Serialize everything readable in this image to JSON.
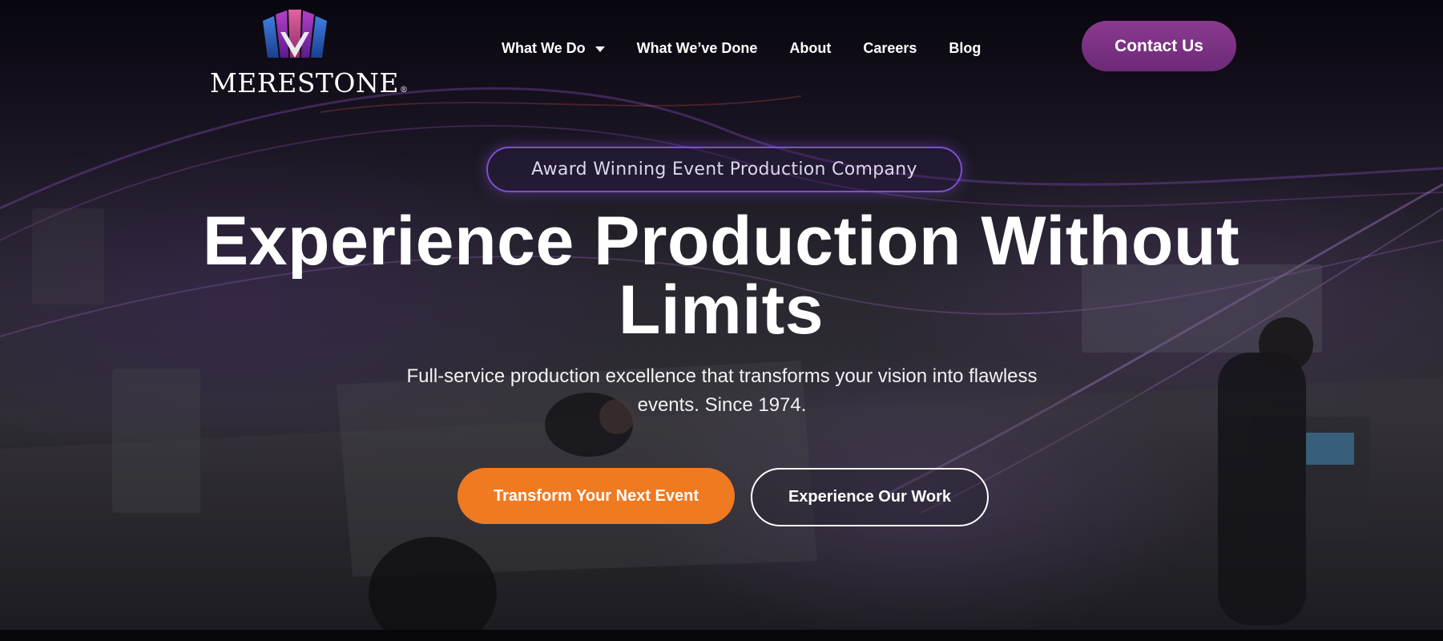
{
  "brand": {
    "logo_text": "MERESTONE",
    "logo_reg": "®"
  },
  "nav": {
    "items": [
      {
        "label": "What We Do"
      },
      {
        "label": "What We’ve Done"
      },
      {
        "label": "About"
      },
      {
        "label": "Careers"
      },
      {
        "label": "Blog"
      }
    ],
    "contact_label": "Contact Us"
  },
  "hero": {
    "badge": "Award Winning Event Production Company",
    "headline_line1": "Experience Production Without",
    "headline_line2": "Limits",
    "subtext_line1": "Full-service production excellence that transforms your vision into flawless",
    "subtext_line2": "events. Since 1974.",
    "primary_cta": "Transform Your Next Event",
    "secondary_cta": "Experience Our Work"
  },
  "colors": {
    "accent_orange": "#f07a22",
    "accent_purple": "#6d2a78",
    "badge_border": "#7e4fd0",
    "background": "#07070c"
  }
}
